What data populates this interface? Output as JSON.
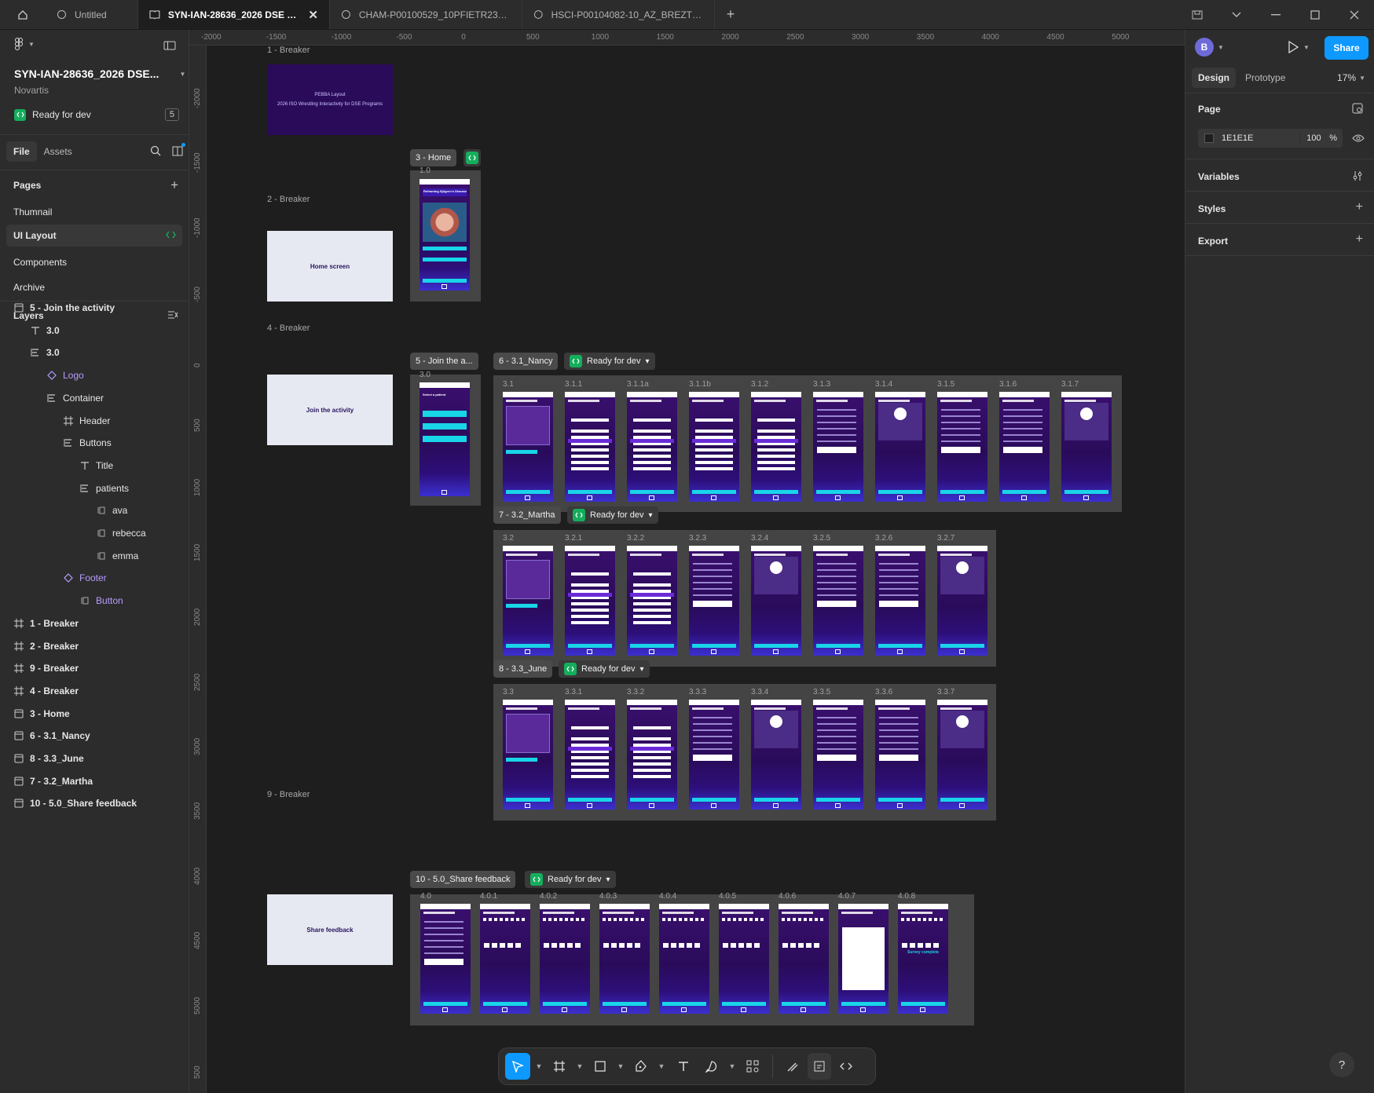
{
  "tabs": [
    {
      "label": "Untitled",
      "active": false
    },
    {
      "label": "SYN-IAN-28636_2026 DSE Core",
      "active": true
    },
    {
      "label": "CHAM-P00100529_10PFIETR23_ETR",
      "active": false
    },
    {
      "label": "HSCI-P00104082-10_AZ_BREZTRI_D",
      "active": false
    }
  ],
  "file": {
    "title": "SYN-IAN-28636_2026 DSE...",
    "org": "Novartis",
    "status": "Ready for dev",
    "status_count": "5"
  },
  "panel_tabs": {
    "file": "File",
    "assets": "Assets"
  },
  "pages": {
    "title": "Pages",
    "items": [
      "Thumnail",
      "UI Layout",
      "Components",
      "Archive"
    ],
    "selected": "UI Layout"
  },
  "layers": {
    "title": "Layers",
    "items": [
      "5 - Join the activity",
      "3.0",
      "3.0",
      "Logo",
      "Container",
      "Header",
      "Buttons",
      "Title",
      "patients",
      "ava",
      "rebecca",
      "emma",
      "Footer",
      "Button",
      "1 - Breaker",
      "2 - Breaker",
      "9 - Breaker",
      "4 - Breaker",
      "3 - Home",
      "6 - 3.1_Nancy",
      "8 - 3.3_June",
      "7 - 3.2_Martha",
      "10 - 5.0_Share feedback"
    ]
  },
  "right": {
    "avatar": "B",
    "share": "Share",
    "tab_design": "Design",
    "tab_prototype": "Prototype",
    "zoom": "17%",
    "page_label": "Page",
    "page_color": "1E1E1E",
    "page_opacity": "100",
    "percent": "%",
    "variables": "Variables",
    "styles": "Styles",
    "export": "Export"
  },
  "ruler": {
    "x": [
      "-2000",
      "-1500",
      "-1000",
      "-500",
      "0",
      "500",
      "1000",
      "1500",
      "2000",
      "2500",
      "3000",
      "3500",
      "4000",
      "4500",
      "5000"
    ],
    "y": [
      "-2000",
      "-1500",
      "-1000",
      "-500",
      "0",
      "500",
      "1000",
      "1500",
      "2000",
      "2500",
      "3000",
      "3500",
      "4000",
      "4500",
      "5000",
      "500"
    ]
  },
  "canvas": {
    "breakers": [
      {
        "label": "1 - Breaker",
        "text_line1": "PEBBA Layout",
        "text_line2": "2026 ISO Wrestling Interactivity for DSE Programs"
      },
      {
        "label": "2 - Breaker",
        "text": "Home screen"
      },
      {
        "label": "4 - Breaker",
        "text": "Join the activity"
      },
      {
        "label": "9 - Breaker",
        "text": "Share feedback"
      }
    ],
    "chips": {
      "home": "3 - Home",
      "join": "5 - Join the a...",
      "nancy": "6 - 3.1_Nancy",
      "martha": "7 - 3.2_Martha",
      "june": "8 - 3.3_June",
      "feedback": "10 - 5.0_Share feedback",
      "ready": "Ready for dev"
    },
    "rows": {
      "home": [
        "1.0"
      ],
      "join": [
        "3.0"
      ],
      "nancy": [
        "3.1",
        "3.1.1",
        "3.1.1a",
        "3.1.1b",
        "3.1.2",
        "3.1.3",
        "3.1.4",
        "3.1.5",
        "3.1.6",
        "3.1.7"
      ],
      "martha": [
        "3.2",
        "3.2.1",
        "3.2.2",
        "3.2.3",
        "3.2.4",
        "3.2.5",
        "3.2.6",
        "3.2.7"
      ],
      "june": [
        "3.3",
        "3.3.1",
        "3.3.2",
        "3.3.3",
        "3.3.4",
        "3.3.5",
        "3.3.6",
        "3.3.7"
      ],
      "feedback": [
        "4.0",
        "4.0.1",
        "4.0.2",
        "4.0.3",
        "4.0.4",
        "4.0.5",
        "4.0.6",
        "4.0.7",
        "4.0.8"
      ]
    },
    "frame_titles": {
      "home": "Reframing Sjögren's Disease",
      "join": "Select a patient",
      "feedback_end": "Survey complete"
    }
  },
  "toolbar": {
    "items": [
      "move-tool",
      "frame-tool",
      "shape-tool",
      "pen-tool",
      "text-tool",
      "comment-tool",
      "actions-tool",
      "draw-mode",
      "design-mode",
      "dev-mode"
    ]
  },
  "colors": {
    "accent": "#0d99ff",
    "ready_green": "#14ae5c",
    "purple_frame": "#2a0b5a",
    "cyan": "#18d5e8",
    "breaker_bg": "#e7e9f2"
  }
}
